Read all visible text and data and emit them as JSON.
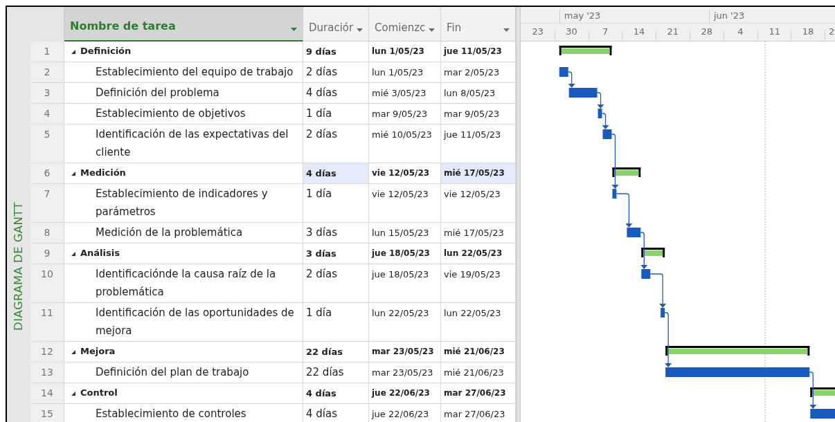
{
  "view_label": "DIAGRAMA DE GANTT",
  "columns": [
    {
      "label": "Nombre de tarea",
      "selected": true
    },
    {
      "label": "Duraciór",
      "selected": false
    },
    {
      "label": "Comienzc",
      "selected": false
    },
    {
      "label": "Fin",
      "selected": false
    }
  ],
  "timescale": {
    "months": [
      "may '23",
      "jun '23"
    ],
    "weeks": [
      "23",
      "30",
      "7",
      "14",
      "21",
      "28",
      "4",
      "11",
      "18",
      "2"
    ]
  },
  "tasks": [
    {
      "id": "1",
      "kind": "summary",
      "expanded": true,
      "name": "Definición",
      "duration": "9 días",
      "start": "lun 1/05/23",
      "finish": "jue 11/05/23",
      "changed": false
    },
    {
      "id": "2",
      "kind": "task",
      "name": "Establecimiento del equipo de trabajo",
      "duration": "2 días",
      "start": "lun 1/05/23",
      "finish": "mar 2/05/23",
      "changed": false,
      "linked": false
    },
    {
      "id": "3",
      "kind": "task",
      "name": "Definición del problema",
      "duration": "4 días",
      "start": "mié 3/05/23",
      "finish": "lun 8/05/23",
      "changed": false,
      "linked": true
    },
    {
      "id": "4",
      "kind": "task",
      "name": "Establecimiento de objetivos",
      "duration": "1 día",
      "start": "mar 9/05/23",
      "finish": "mar 9/05/23",
      "changed": false,
      "linked": true
    },
    {
      "id": "5",
      "kind": "task",
      "name": "Identificación de las expectativas del cliente",
      "duration": "2 días",
      "start": "mié 10/05/23",
      "finish": "jue 11/05/23",
      "changed": false,
      "linked": true
    },
    {
      "id": "6",
      "kind": "summary",
      "expanded": true,
      "name": "Medición",
      "duration": "4 días",
      "start": "vie 12/05/23",
      "finish": "mié 17/05/23",
      "changed": true
    },
    {
      "id": "7",
      "kind": "task",
      "name": "Establecimiento de indicadores y parámetros",
      "duration": "1 día",
      "start": "vie 12/05/23",
      "finish": "vie 12/05/23",
      "changed": false,
      "linked": true
    },
    {
      "id": "8",
      "kind": "task",
      "name": "Medición de la problemática",
      "duration": "3 días",
      "start": "lun 15/05/23",
      "finish": "mié 17/05/23",
      "changed": false,
      "linked": true
    },
    {
      "id": "9",
      "kind": "summary",
      "expanded": true,
      "name": "Análisis",
      "duration": "3 días",
      "start": "jue 18/05/23",
      "finish": "lun 22/05/23",
      "changed": false
    },
    {
      "id": "10",
      "kind": "task",
      "name": "Identificaciónde la causa raíz de la problemática",
      "duration": "2 días",
      "start": "jue 18/05/23",
      "finish": "vie 19/05/23",
      "changed": false,
      "linked": true
    },
    {
      "id": "11",
      "kind": "task",
      "name": "Identificación de las oportunidades de mejora",
      "duration": "1 día",
      "start": "lun 22/05/23",
      "finish": "lun 22/05/23",
      "changed": false,
      "linked": true
    },
    {
      "id": "12",
      "kind": "summary",
      "expanded": true,
      "name": "Mejora",
      "duration": "22 días",
      "start": "mar 23/05/23",
      "finish": "mié 21/06/23",
      "changed": false
    },
    {
      "id": "13",
      "kind": "task",
      "name": "Definición del plan de trabajo",
      "duration": "22 días",
      "start": "mar 23/05/23",
      "finish": "mié 21/06/23",
      "changed": false,
      "linked": true
    },
    {
      "id": "14",
      "kind": "summary",
      "expanded": true,
      "name": "Control",
      "duration": "4 días",
      "start": "jue 22/06/23",
      "finish": "mar 27/06/23",
      "changed": false
    },
    {
      "id": "15",
      "kind": "task",
      "name": "Establecimiento de controles",
      "duration": "4 días",
      "start": "jue 22/06/23",
      "finish": "mar 27/06/23",
      "changed": false,
      "linked": true
    }
  ]
}
